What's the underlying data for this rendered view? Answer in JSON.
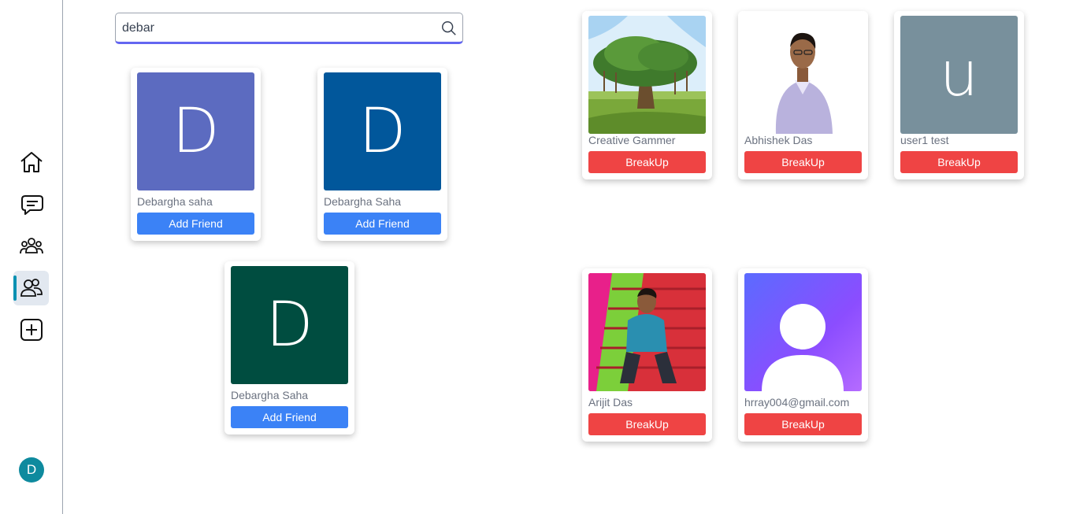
{
  "search": {
    "value": "debar",
    "placeholder": ""
  },
  "nav": {
    "items": [
      {
        "name": "home",
        "icon": "home-icon",
        "active": false
      },
      {
        "name": "chats",
        "icon": "chat-bubbles-icon",
        "active": false
      },
      {
        "name": "groups",
        "icon": "group-icon",
        "active": false
      },
      {
        "name": "friends",
        "icon": "friends-icon",
        "active": true
      },
      {
        "name": "create",
        "icon": "plus-square-icon",
        "active": false
      }
    ],
    "user_initial": "D"
  },
  "search_results": [
    {
      "initial": "D",
      "name": "Debargha saha",
      "button": "Add Friend",
      "color": "#5c6bc0"
    },
    {
      "initial": "D",
      "name": "Debargha Saha",
      "button": "Add Friend",
      "color": "#01579b"
    },
    {
      "initial": "D",
      "name": "Debargha Saha",
      "button": "Add Friend",
      "color": "#004d40"
    }
  ],
  "friends": [
    {
      "name": "Creative Gammer",
      "button": "BreakUp",
      "picture": "tree-illustration"
    },
    {
      "name": "Abhishek Das",
      "button": "BreakUp",
      "picture": "man-portrait"
    },
    {
      "name": "user1 test",
      "button": "BreakUp",
      "initial": "u",
      "color": "#78909c"
    },
    {
      "name": "Arijit Das",
      "button": "BreakUp",
      "picture": "man-on-stairs-photo"
    },
    {
      "name": "hrray004@gmail.com",
      "button": "BreakUp",
      "picture": "default-avatar"
    }
  ],
  "colors": {
    "add": "#3b82f6",
    "breakup": "#ef4444",
    "accent": "#6366f1",
    "active_indicator": "#0891b2"
  }
}
